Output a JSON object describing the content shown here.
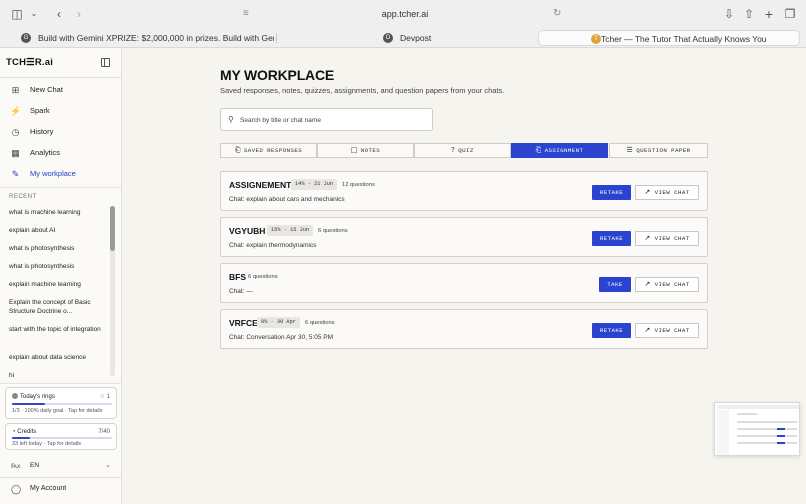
{
  "browser": {
    "url": "app.tcher.ai",
    "tabs": [
      {
        "label": "Build with Gemini XPRIZE: $2,000,000 in prizes. Build with Gemini....",
        "favicon": "G"
      },
      {
        "label": "Devpost",
        "favicon": "D"
      },
      {
        "label": "Tcher — The Tutor That Actually Knows You",
        "favicon": "T"
      }
    ]
  },
  "sidebar": {
    "logo": "TCH☰R.ai",
    "nav": [
      {
        "label": "New Chat",
        "icon": "new-chat-icon",
        "glyph": "⊞"
      },
      {
        "label": "Spark",
        "icon": "lightning-icon",
        "glyph": "⚡"
      },
      {
        "label": "History",
        "icon": "clock-icon",
        "glyph": "◷"
      },
      {
        "label": "Analytics",
        "icon": "grid-icon",
        "glyph": "▦"
      },
      {
        "label": "My workplace",
        "icon": "edit-icon",
        "glyph": "✎"
      }
    ],
    "recent_heading": "RECENT",
    "recent": [
      "what is machine learning",
      "explain about AI",
      "what is photosynthesis",
      "what is photosynthesis",
      "explain machine learning",
      "Explain the concept of Basic Structure Doctrine o...",
      "start with the topic of integration",
      "explain about data science",
      "hi"
    ],
    "rings": {
      "title": "Today's rings",
      "streak": "♢ 1",
      "subtitle": "1/3 · 100% daily goal · Tap for details",
      "progress": 0.33
    },
    "credits": {
      "title": "Credits",
      "count": "7/40",
      "subtitle": "33 left today · Tap for details",
      "progress": 0.175
    },
    "language": "EN",
    "account": "My Account"
  },
  "main": {
    "title": "MY WORKPLACE",
    "subtitle": "Saved responses, notes, quizzes, assignments, and question papers from your chats.",
    "search_placeholder": "Search by title or chat name",
    "filter_tabs": [
      {
        "label": "SAVED RESPONSES",
        "glyph": "⎗"
      },
      {
        "label": "NOTES",
        "glyph": "□"
      },
      {
        "label": "QUIZ",
        "glyph": "?"
      },
      {
        "label": "ASSIGNMENT",
        "glyph": "⎗"
      },
      {
        "label": "QUESTION PAPER",
        "glyph": "☰"
      }
    ],
    "items": [
      {
        "title": "ASSIGNEMENT",
        "badge": "14% · 21 Jun",
        "count": "12 questions",
        "chat": "Chat: explain about cars and mechanics",
        "action": "RETAKE",
        "view": "VIEW CHAT"
      },
      {
        "title": "VGYUBH",
        "badge": "15% · 15 Jun",
        "count": "6 questions",
        "chat": "Chat: explain thermodynamics",
        "action": "RETAKE",
        "view": "VIEW CHAT"
      },
      {
        "title": "BFS",
        "badge": "",
        "count": "6 questions",
        "chat": "Chat: —",
        "action": "TAKE",
        "view": "VIEW CHAT"
      },
      {
        "title": "VRFCE",
        "badge": "0% · 30 Apr",
        "count": "6 questions",
        "chat": "Chat: Conversation Apr 30, 5:05 PM",
        "action": "RETAKE",
        "view": "VIEW CHAT"
      }
    ]
  }
}
